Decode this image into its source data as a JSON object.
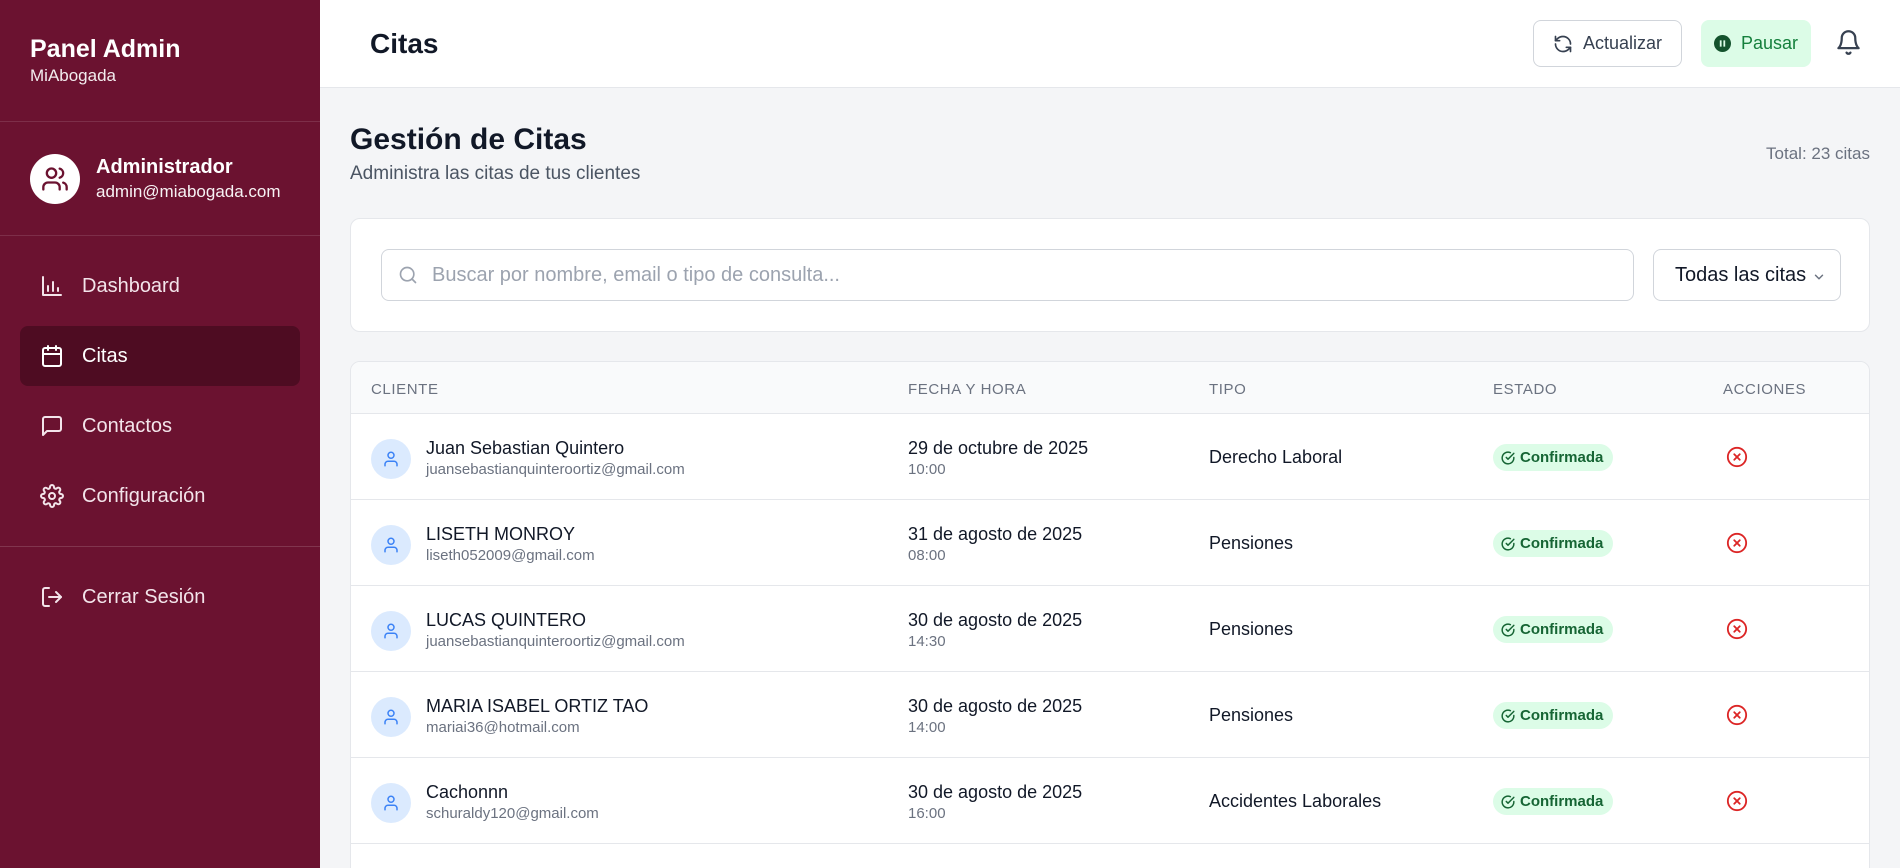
{
  "sidebar": {
    "title": "Panel Admin",
    "subtitle": "MiAbogada",
    "user": {
      "name": "Administrador",
      "email": "admin@miabogada.com"
    },
    "items": [
      {
        "label": "Dashboard",
        "icon": "bar-chart-icon"
      },
      {
        "label": "Citas",
        "icon": "calendar-icon",
        "active": true
      },
      {
        "label": "Contactos",
        "icon": "message-square-icon"
      },
      {
        "label": "Configuración",
        "icon": "gear-icon"
      }
    ],
    "logout": "Cerrar Sesión"
  },
  "header": {
    "title": "Citas",
    "refresh_label": "Actualizar",
    "pause_label": "Pausar"
  },
  "main": {
    "title": "Gestión de Citas",
    "subtitle": "Administra las citas de tus clientes",
    "total": "Total: 23 citas",
    "search_placeholder": "Buscar por nombre, email o tipo de consulta...",
    "filter_value": "Todas las citas"
  },
  "table": {
    "columns": [
      "CLIENTE",
      "FECHA Y HORA",
      "TIPO",
      "ESTADO",
      "ACCIONES"
    ],
    "rows": [
      {
        "name": "Juan Sebastian Quintero",
        "email": "juansebastianquinteroortiz@gmail.com",
        "date": "29 de octubre de 2025",
        "time": "10:00",
        "type": "Derecho Laboral",
        "status": "Confirmada"
      },
      {
        "name": "LISETH MONROY",
        "email": "liseth052009@gmail.com",
        "date": "31 de agosto de 2025",
        "time": "08:00",
        "type": "Pensiones",
        "status": "Confirmada"
      },
      {
        "name": "LUCAS QUINTERO",
        "email": "juansebastianquinteroortiz@gmail.com",
        "date": "30 de agosto de 2025",
        "time": "14:30",
        "type": "Pensiones",
        "status": "Confirmada"
      },
      {
        "name": "MARIA ISABEL ORTIZ TAO",
        "email": "mariai36@hotmail.com",
        "date": "30 de agosto de 2025",
        "time": "14:00",
        "type": "Pensiones",
        "status": "Confirmada"
      },
      {
        "name": "Cachonnn",
        "email": "schuraldy120@gmail.com",
        "date": "30 de agosto de 2025",
        "time": "16:00",
        "type": "Accidentes Laborales",
        "status": "Confirmada"
      }
    ]
  },
  "colors": {
    "sidebar_bg": "#6b1230",
    "sidebar_active": "#4e0c22",
    "status_green": "#166534",
    "cancel_red": "#dc2626"
  }
}
